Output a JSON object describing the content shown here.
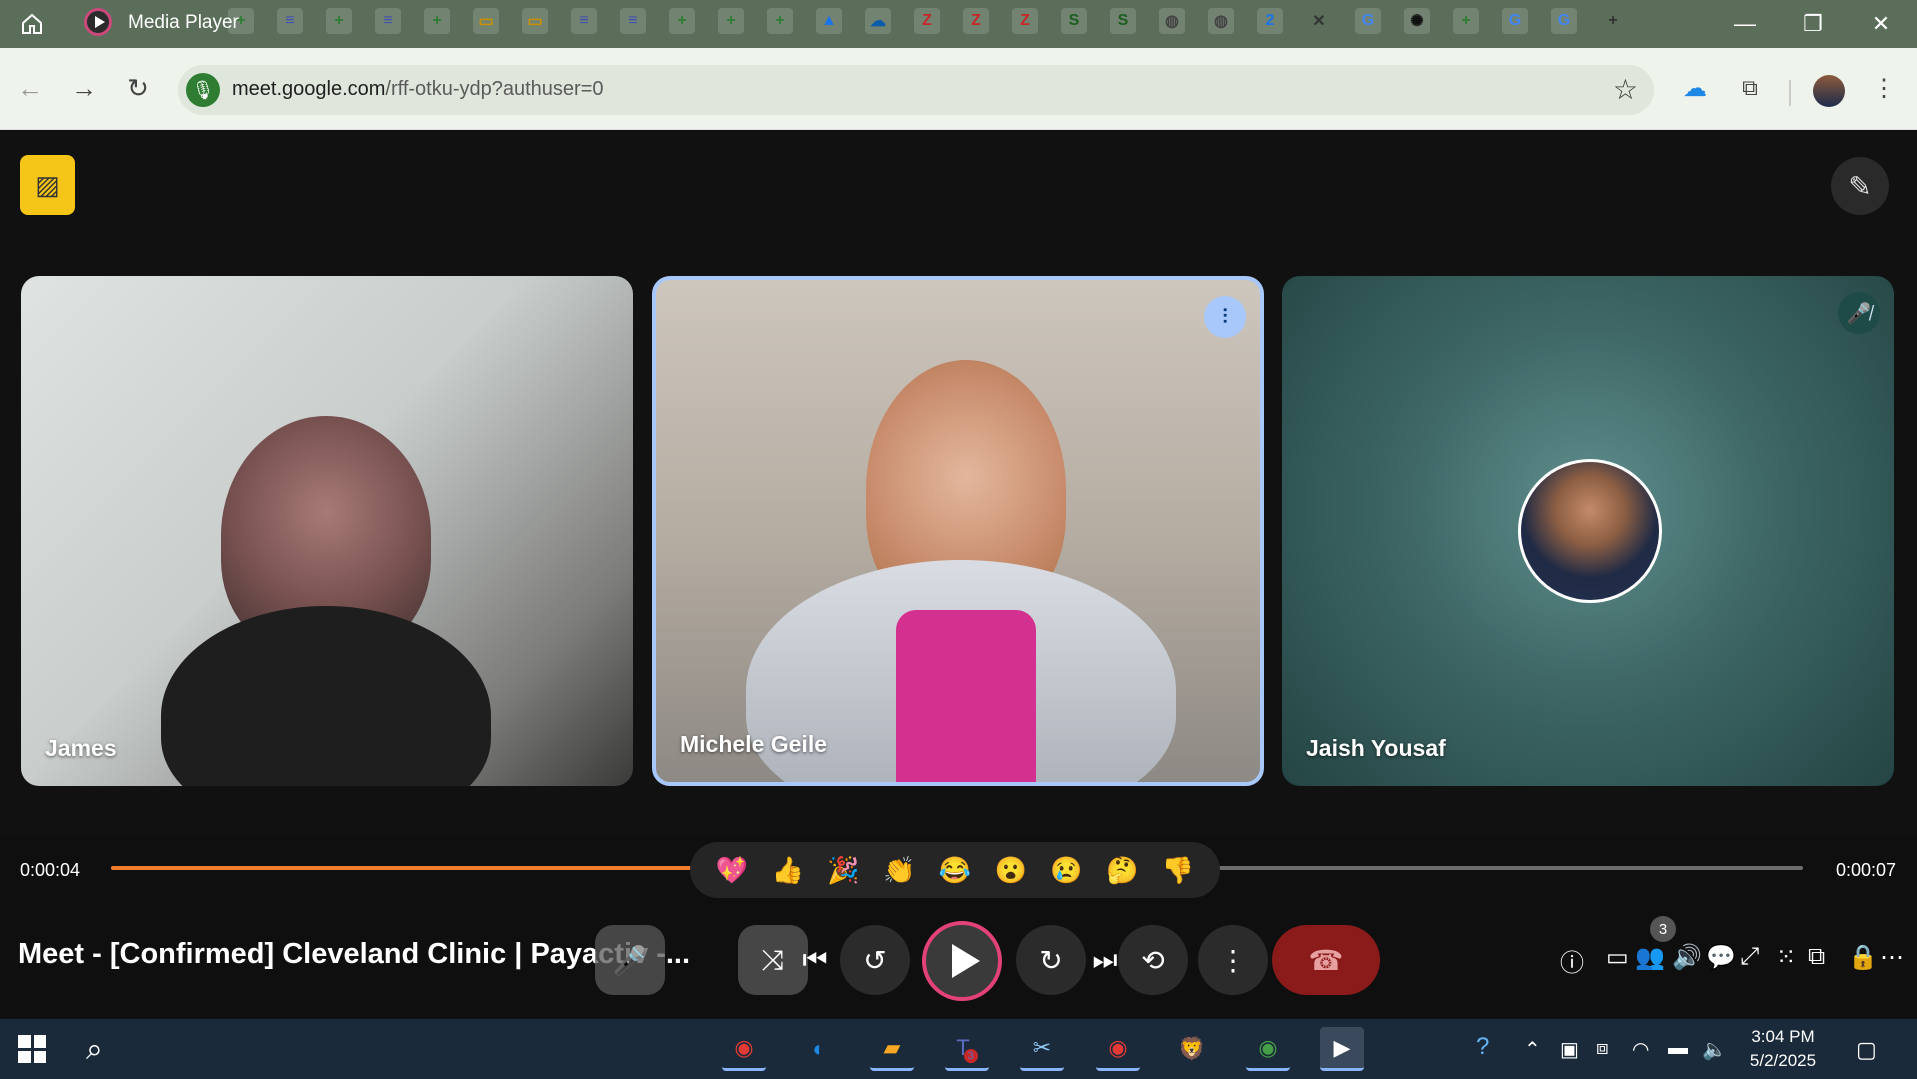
{
  "window": {
    "title": "Media Player",
    "controls": {
      "minimize": "—",
      "restore": "❐",
      "close": "✕"
    }
  },
  "tabs": [
    {
      "icon": "sheets",
      "glyph": "+",
      "color": "#2e7d32"
    },
    {
      "icon": "docs",
      "glyph": "≡",
      "color": "#3f51b5"
    },
    {
      "icon": "sheets",
      "glyph": "+",
      "color": "#2e7d32"
    },
    {
      "icon": "docs",
      "glyph": "≡",
      "color": "#3f51b5"
    },
    {
      "icon": "sheets",
      "glyph": "+",
      "color": "#2e7d32"
    },
    {
      "icon": "slides",
      "glyph": "▭",
      "color": "#c79100"
    },
    {
      "icon": "slides",
      "glyph": "▭",
      "color": "#c79100"
    },
    {
      "icon": "docs",
      "glyph": "≡",
      "color": "#3f51b5"
    },
    {
      "icon": "docs",
      "glyph": "≡",
      "color": "#3f51b5"
    },
    {
      "icon": "sheets",
      "glyph": "+",
      "color": "#2e7d32"
    },
    {
      "icon": "sheets",
      "glyph": "+",
      "color": "#2e7d32"
    },
    {
      "icon": "sheets",
      "glyph": "+",
      "color": "#2e7d32"
    },
    {
      "icon": "drive",
      "glyph": "▲",
      "color": "#1a73e8"
    },
    {
      "icon": "salesforce",
      "glyph": "☁",
      "color": "#0b5cab"
    },
    {
      "icon": "zoho",
      "glyph": "Z",
      "color": "#c62828"
    },
    {
      "icon": "zoho",
      "glyph": "Z",
      "color": "#c62828"
    },
    {
      "icon": "zoho",
      "glyph": "Z",
      "color": "#c62828"
    },
    {
      "icon": "s-app",
      "glyph": "S",
      "color": "#1b5e20"
    },
    {
      "icon": "s-app",
      "glyph": "S",
      "color": "#1b5e20"
    },
    {
      "icon": "globe",
      "glyph": "◍",
      "color": "#444"
    },
    {
      "icon": "globe",
      "glyph": "◍",
      "color": "#444"
    },
    {
      "icon": "calendar",
      "glyph": "2",
      "color": "#1a73e8"
    },
    {
      "icon": "close-tab",
      "glyph": "✕",
      "color": "#333"
    },
    {
      "icon": "google",
      "glyph": "G",
      "color": "#4285f4"
    },
    {
      "icon": "openai",
      "glyph": "✺",
      "color": "#111"
    },
    {
      "icon": "sheets",
      "glyph": "+",
      "color": "#2e7d32"
    },
    {
      "icon": "google",
      "glyph": "G",
      "color": "#4285f4"
    },
    {
      "icon": "google",
      "glyph": "G",
      "color": "#4285f4"
    },
    {
      "icon": "new-tab",
      "glyph": "+",
      "color": "#333"
    }
  ],
  "address_bar": {
    "domain": "meet.google.com",
    "path": "/rff-otku-ydp?authuser=0"
  },
  "participants": [
    {
      "name": "James",
      "state": "none"
    },
    {
      "name": "Michele Geile",
      "state": "speaking"
    },
    {
      "name": "Jaish Yousaf",
      "state": "muted"
    }
  ],
  "player": {
    "time_current": "0:00:04",
    "time_total": "0:00:07",
    "progress": 0.394,
    "title": "Meet - [Confirmed] Cleveland Clinic | Payactiv -...",
    "participant_count": "3",
    "reactions": [
      "💖",
      "👍",
      "🎉",
      "👏",
      "😂",
      "😮",
      "😢",
      "🤔",
      "👎"
    ]
  },
  "taskbar": {
    "time": "3:04 PM",
    "date": "5/2/2025",
    "teams_badge": "3"
  },
  "colors": {
    "accent": "#f17d2a",
    "speaking_border": "#a8c7fa",
    "hangup": "#8b1a1a"
  }
}
